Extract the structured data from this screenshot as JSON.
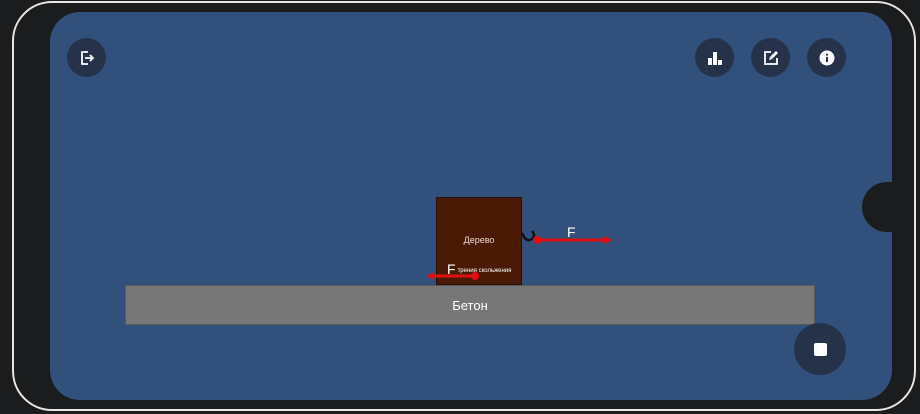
{
  "toolbar": {
    "exit_icon": "logout-icon",
    "stats_icon": "bar-chart-icon",
    "edit_icon": "edit-icon",
    "info_icon": "info-icon",
    "stop_icon": "stop-icon"
  },
  "scene": {
    "surface_material": "Бетон",
    "block_material": "Дерево",
    "applied_force_label": "F",
    "friction_force_label": "F",
    "friction_force_subscript": "трения скольжения"
  },
  "colors": {
    "screen_background": "#31517c",
    "button_background": "#26324a",
    "force_arrow": "#e01010",
    "block": "#4a1a04",
    "surface": "#777777"
  }
}
